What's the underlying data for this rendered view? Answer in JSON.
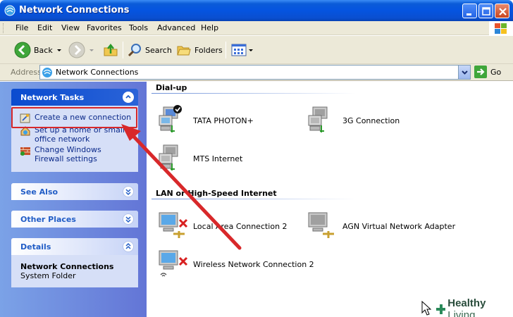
{
  "window": {
    "title": "Network Connections",
    "icon": "network-connections-icon"
  },
  "menu": [
    "File",
    "Edit",
    "View",
    "Favorites",
    "Tools",
    "Advanced",
    "Help"
  ],
  "toolbar": {
    "back_label": "Back",
    "search_label": "Search",
    "folders_label": "Folders"
  },
  "address": {
    "label": "Address",
    "value": "Network Connections",
    "go_label": "Go"
  },
  "left_panel": {
    "network_tasks": {
      "title": "Network Tasks",
      "items": [
        {
          "label": "Create a new connection",
          "icon": "new-connection-icon"
        },
        {
          "label": "Set up a home or small office network",
          "icon": "home-network-icon"
        },
        {
          "label": "Change Windows Firewall settings",
          "icon": "firewall-icon"
        }
      ]
    },
    "see_also": {
      "title": "See Also"
    },
    "other_places": {
      "title": "Other Places"
    },
    "details": {
      "title": "Details",
      "name": "Network Connections",
      "type": "System Folder"
    }
  },
  "groups": [
    {
      "title": "Dial-up",
      "items": [
        {
          "label": "TATA PHOTON+",
          "icon": "dialup-connected-icon"
        },
        {
          "label": "3G Connection",
          "icon": "dialup-icon"
        },
        {
          "label": "MTS Internet",
          "icon": "dialup-icon"
        }
      ]
    },
    {
      "title": "LAN or High-Speed Internet",
      "items": [
        {
          "label": "Local Area Connection 2",
          "icon": "lan-disconnected-icon"
        },
        {
          "label": "AGN Virtual Network Adapter",
          "icon": "lan-icon"
        },
        {
          "label": "Wireless Network Connection 2",
          "icon": "wireless-disconnected-icon"
        }
      ]
    }
  ],
  "watermark": {
    "brand_bold": "Healthy",
    "brand_light": "Living"
  },
  "colors": {
    "title_bar": "#0554e0",
    "task_pane": "#6375d6",
    "annotation_red": "#d8282a"
  }
}
